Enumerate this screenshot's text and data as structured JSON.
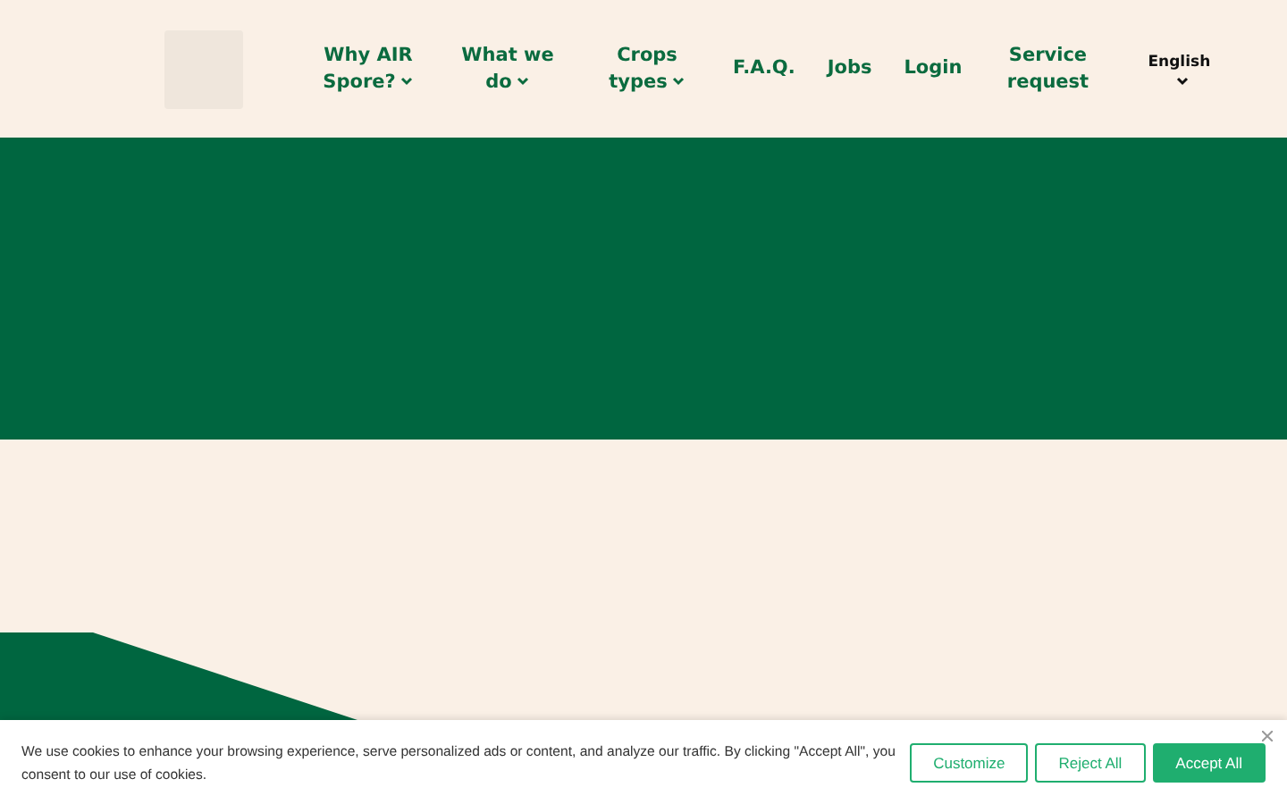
{
  "header": {
    "nav": [
      {
        "label": "Why AIR Spore?",
        "dropdown": true
      },
      {
        "label": "What we do",
        "dropdown": true
      },
      {
        "label": "Crops types",
        "dropdown": true
      },
      {
        "label": "F.A.Q.",
        "dropdown": false
      },
      {
        "label": "Jobs",
        "dropdown": false
      },
      {
        "label": "Login",
        "dropdown": false
      },
      {
        "label": "Service request",
        "dropdown": false
      }
    ],
    "language": {
      "label": "English",
      "dropdown": true
    }
  },
  "cookie_banner": {
    "text": "We use cookies to enhance your browsing experience, serve personalized ads or content, and analyze our traffic. By clicking \"Accept All\", you consent to our use of cookies.",
    "buttons": [
      {
        "label": "Customize",
        "kind": "outline"
      },
      {
        "label": "Reject All",
        "kind": "outline"
      },
      {
        "label": "Accept All",
        "kind": "primary"
      }
    ]
  }
}
